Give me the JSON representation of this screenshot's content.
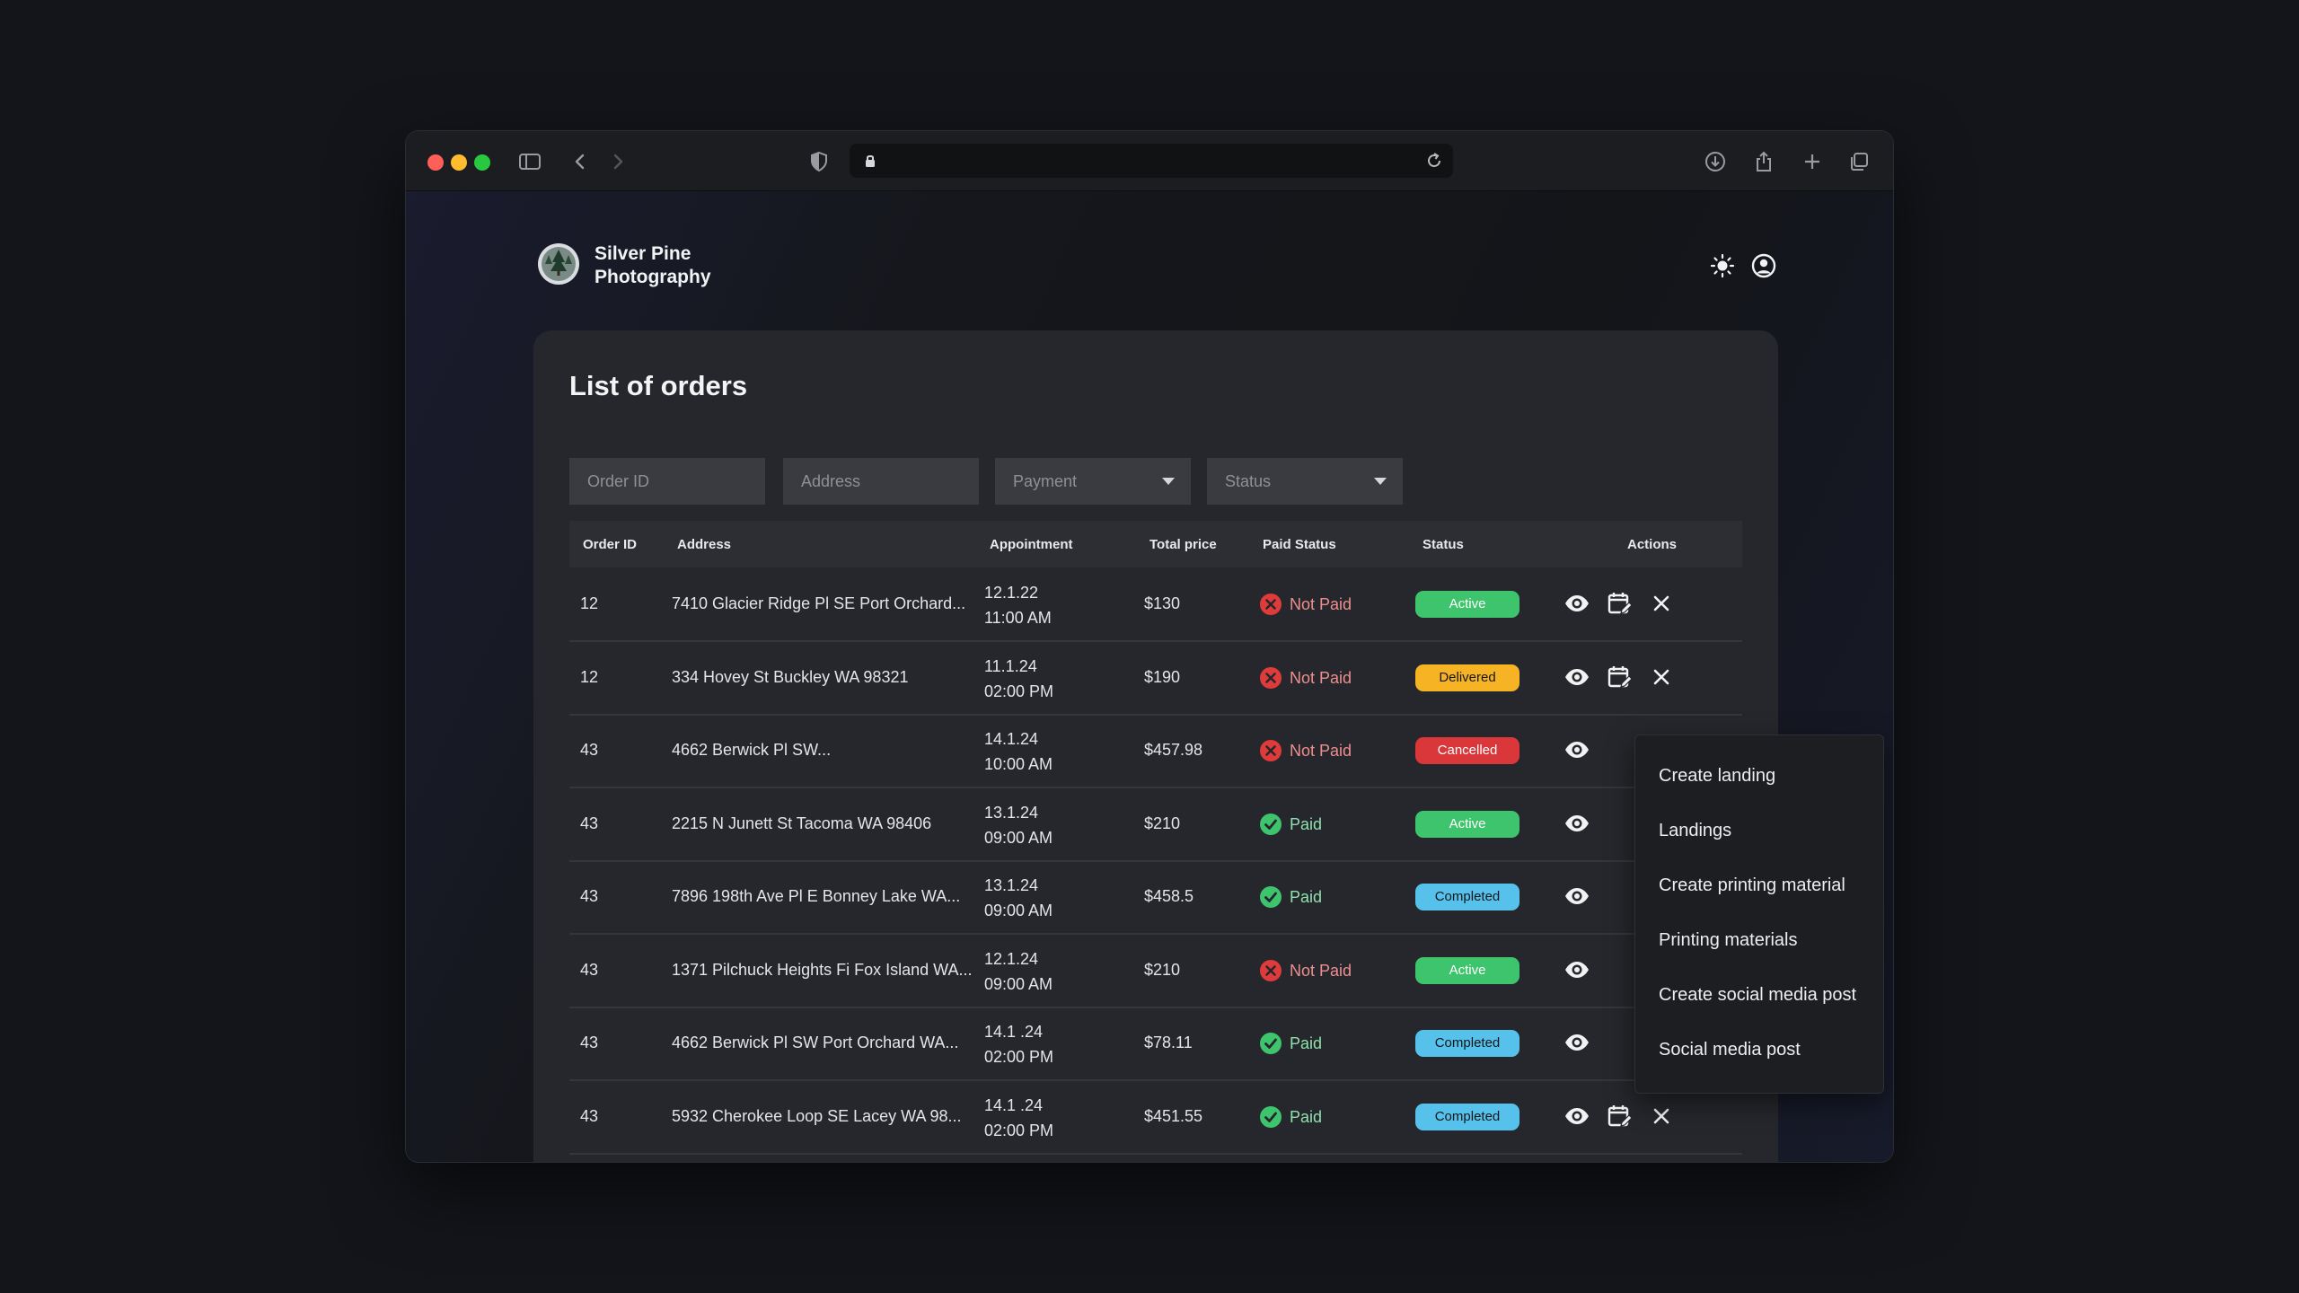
{
  "brand": {
    "line1": "Silver Pine",
    "line2": "Photography"
  },
  "page": {
    "title": "List of orders"
  },
  "filters": {
    "order_id_placeholder": "Order ID",
    "address_placeholder": "Address",
    "payment_label": "Payment",
    "status_label": "Status"
  },
  "table": {
    "headers": {
      "order_id": "Order ID",
      "address": "Address",
      "appointment": "Appointment",
      "total_price": "Total price",
      "paid_status": "Paid Status",
      "status": "Status",
      "actions": "Actions"
    },
    "rows": [
      {
        "id": "12",
        "address": "7410 Glacier Ridge Pl SE Port Orchard...",
        "date": "12.1.22",
        "time": "11:00 AM",
        "price": "$130",
        "paid": "Not Paid",
        "status": "Active"
      },
      {
        "id": "12",
        "address": "334 Hovey St Buckley WA 98321",
        "date": "11.1.24",
        "time": "02:00 PM",
        "price": "$190",
        "paid": "Not Paid",
        "status": "Delivered"
      },
      {
        "id": "43",
        "address": "4662 Berwick Pl SW...",
        "date": "14.1.24",
        "time": "10:00 AM",
        "price": "$457.98",
        "paid": "Not Paid",
        "status": "Cancelled"
      },
      {
        "id": "43",
        "address": "2215 N Junett St Tacoma WA 98406",
        "date": "13.1.24",
        "time": "09:00 AM",
        "price": "$210",
        "paid": "Paid",
        "status": "Active"
      },
      {
        "id": "43",
        "address": "7896 198th Ave Pl E Bonney Lake WA...",
        "date": "13.1.24",
        "time": "09:00 AM",
        "price": "$458.5",
        "paid": "Paid",
        "status": "Completed"
      },
      {
        "id": "43",
        "address": "1371 Pilchuck Heights Fi Fox Island WA...",
        "date": "12.1.24",
        "time": "09:00 AM",
        "price": "$210",
        "paid": "Not Paid",
        "status": "Active"
      },
      {
        "id": "43",
        "address": "4662 Berwick Pl SW Port Orchard WA...",
        "date": "14.1 .24",
        "time": "02:00 PM",
        "price": "$78.11",
        "paid": "Paid",
        "status": "Completed"
      },
      {
        "id": "43",
        "address": "5932 Cherokee Loop SE Lacey WA 98...",
        "date": "14.1 .24",
        "time": "02:00 PM",
        "price": "$451.55",
        "paid": "Paid",
        "status": "Completed"
      }
    ]
  },
  "menu": {
    "items": [
      "Create landing",
      "Landings",
      "Create printing material",
      "Printing materials",
      "Create social media post",
      "Social media post"
    ]
  },
  "icons": {
    "sidebar": "sidebar-icon",
    "back": "chevron-left-icon",
    "forward": "chevron-right-icon",
    "shield": "shield-icon",
    "lock": "lock-icon",
    "reload": "reload-icon",
    "download": "download-icon",
    "share": "share-icon",
    "new_tab": "plus-icon",
    "tabs": "tabs-icon",
    "theme": "sun-icon",
    "account": "user-circle-icon",
    "view": "eye-icon",
    "schedule": "calendar-edit-icon",
    "delete": "close-icon"
  },
  "colors": {
    "Active": "#3ec46d",
    "Delivered": "#f6b324",
    "Cancelled": "#d9373a",
    "Completed": "#56c2ec",
    "paid": "#3ec46d",
    "not_paid": "#e03b3b",
    "not_paid_text": "#ee8f8f",
    "paid_text": "#8fe0ad"
  }
}
